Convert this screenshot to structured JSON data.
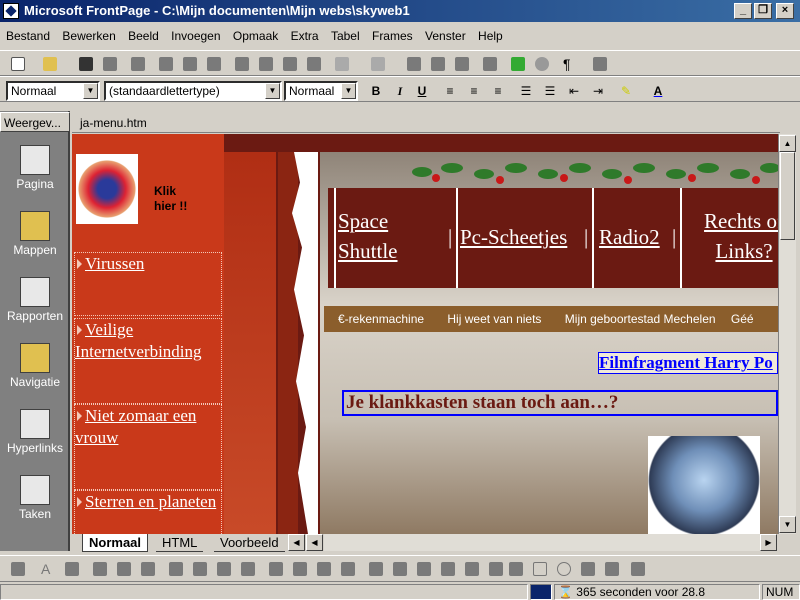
{
  "window": {
    "title": "Microsoft FrontPage - C:\\Mijn documenten\\Mijn webs\\skyweb1"
  },
  "menu": [
    "Bestand",
    "Bewerken",
    "Beeld",
    "Invoegen",
    "Opmaak",
    "Extra",
    "Tabel",
    "Frames",
    "Venster",
    "Help"
  ],
  "format_bar": {
    "style": "Normaal",
    "font": "(standaardlettertype)",
    "size": "Normaal"
  },
  "views": {
    "title": "Weergev...",
    "items": [
      "Pagina",
      "Mappen",
      "Rapporten",
      "Navigatie",
      "Hyperlinks",
      "Taken"
    ]
  },
  "document": {
    "tab": "ja-menu.htm"
  },
  "page": {
    "click_label": "Klik\nhier !!",
    "left_nav": [
      "Virussen",
      "Veilige Internetverbinding",
      "Niet zomaar een vrouw",
      "Sterren en planeten"
    ],
    "top_nav": [
      "Space Shuttle",
      "Pc-Scheetjes",
      "Radio2",
      "Rechts of Links?"
    ],
    "top_sep": "|",
    "sub_nav": [
      "€-rekenmachine",
      "Hij weet van niets",
      "Mijn geboortestad Mechelen",
      "Géé"
    ],
    "film_link": "Filmfragment Harry Po",
    "headline": "Je klankkasten staan toch aan…?"
  },
  "bottom_tabs": [
    "Normaal",
    "HTML",
    "Voorbeeld"
  ],
  "status": {
    "time": "365 seconden voor 28.8",
    "num": "NUM"
  },
  "colors": {
    "title_bar": "#0a246a",
    "nav_red": "#c9391a",
    "dark_red": "#6b1a12",
    "link_blue": "#0000ff"
  }
}
